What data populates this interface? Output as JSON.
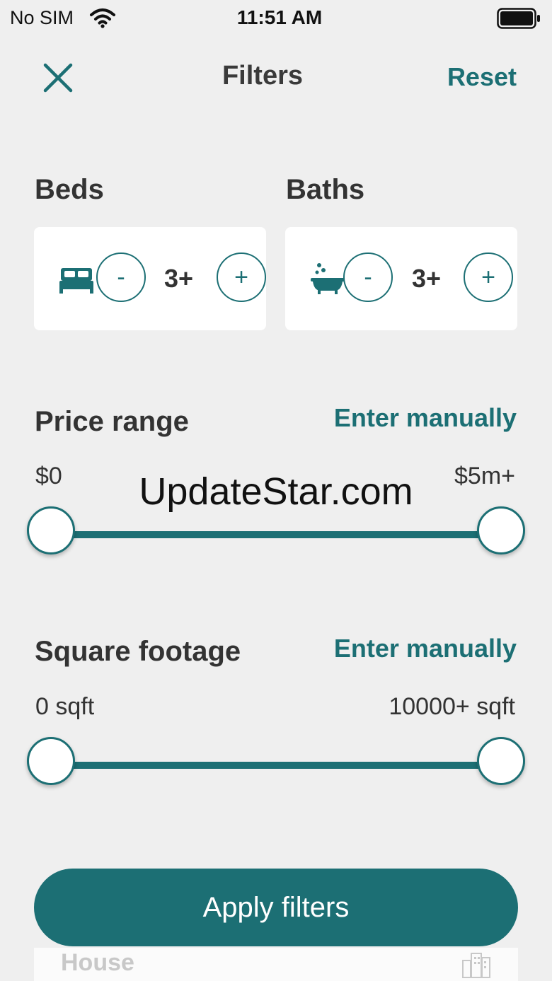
{
  "status_bar": {
    "carrier": "No SIM",
    "time": "11:51 AM"
  },
  "header": {
    "title": "Filters",
    "reset_label": "Reset"
  },
  "beds": {
    "label": "Beds",
    "decrement": "-",
    "value": "3+",
    "increment": "+",
    "icon": "bed-icon"
  },
  "baths": {
    "label": "Baths",
    "decrement": "-",
    "value": "3+",
    "increment": "+",
    "icon": "bathtub-icon"
  },
  "price": {
    "label": "Price range",
    "manual_label": "Enter manually",
    "min_label": "$0",
    "max_label": "$5m+",
    "selected_min_fraction": 0,
    "selected_max_fraction": 1
  },
  "sqft": {
    "label": "Square footage",
    "manual_label": "Enter manually",
    "min_label": "0 sqft",
    "max_label": "10000+ sqft",
    "selected_min_fraction": 0,
    "selected_max_fraction": 1
  },
  "watermark": "UpdateStar.com",
  "apply_label": "Apply filters",
  "bottom_card": {
    "label": "House",
    "icon": "building-icon"
  },
  "colors": {
    "accent": "#1c6f74",
    "background": "#efefef",
    "card": "#ffffff"
  }
}
